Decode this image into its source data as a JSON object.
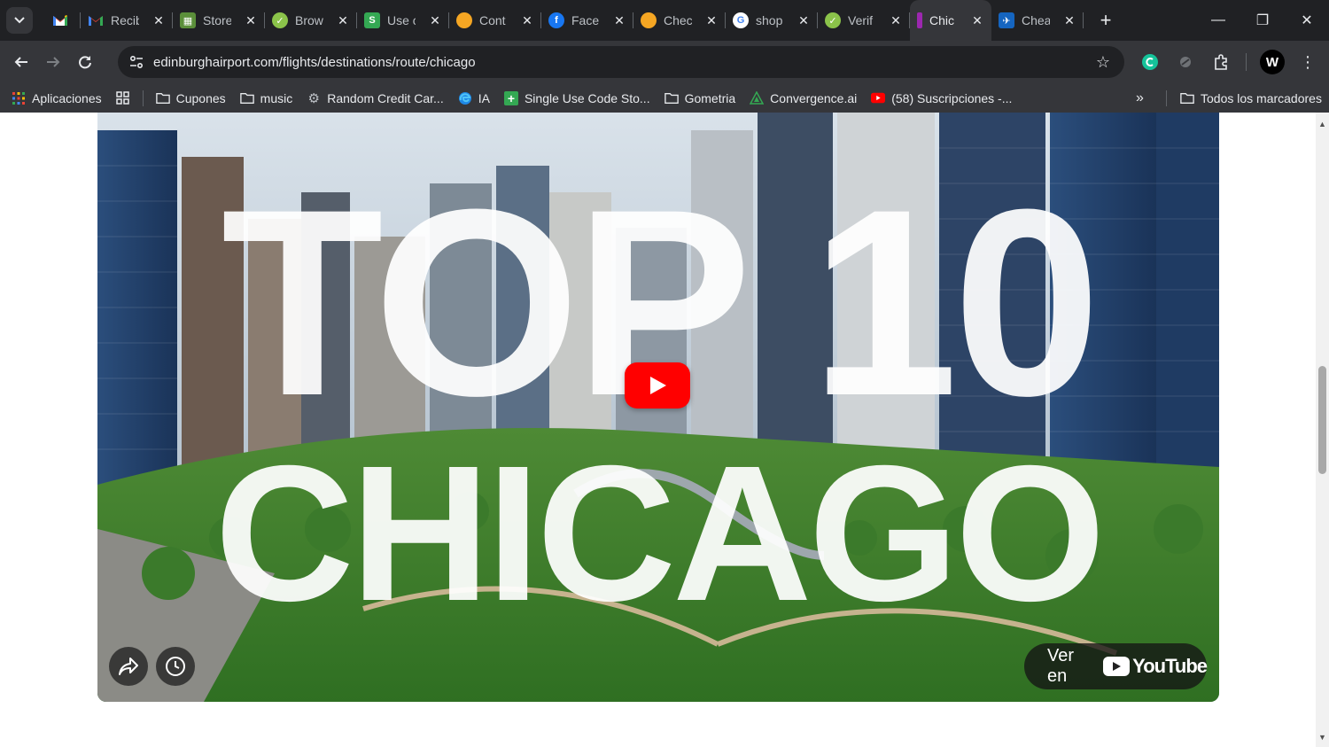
{
  "browser": {
    "tabs": [
      {
        "title": "",
        "icon": "gmail-icon",
        "color": "#ea4335"
      },
      {
        "title": "Recib",
        "icon": "gmail-icon",
        "color": "#ea4335"
      },
      {
        "title": "Store",
        "icon": "store-icon",
        "color": "#4caf50"
      },
      {
        "title": "Brow",
        "icon": "check-circle-icon",
        "color": "#7cb342"
      },
      {
        "title": "Use c",
        "icon": "s-icon",
        "color": "#34a853"
      },
      {
        "title": "Cont",
        "icon": "honey-icon",
        "color": "#f5a623"
      },
      {
        "title": "Facel",
        "icon": "facebook-icon",
        "color": "#1877f2"
      },
      {
        "title": "Chec",
        "icon": "honey-icon",
        "color": "#f5a623"
      },
      {
        "title": "shop",
        "icon": "google-icon",
        "color": "#4285f4"
      },
      {
        "title": "Verif",
        "icon": "check-circle-icon",
        "color": "#7cb342"
      },
      {
        "title": "Chic",
        "icon": "airport-icon",
        "color": "#9c27b0",
        "active": true
      },
      {
        "title": "Chea",
        "icon": "plane-icon",
        "color": "#1565c0"
      }
    ],
    "address_bar": {
      "url": "edinburghairport.com/flights/destinations/route/chicago"
    },
    "bookmarks": [
      {
        "label": "Aplicaciones",
        "icon": "apps-grid-icon"
      },
      {
        "label": "",
        "icon": "grid-icon"
      },
      {
        "label": "Cupones",
        "icon": "folder-icon"
      },
      {
        "label": "music",
        "icon": "folder-icon"
      },
      {
        "label": "Random Credit Car...",
        "icon": "gear-icon"
      },
      {
        "label": "IA",
        "icon": "edge-icon"
      },
      {
        "label": "Single Use Code Sto...",
        "icon": "plus-icon"
      },
      {
        "label": "Gometria",
        "icon": "folder-icon"
      },
      {
        "label": "Convergence.ai",
        "icon": "convergence-icon"
      },
      {
        "label": "(58) Suscripciones -...",
        "icon": "youtube-icon"
      }
    ],
    "all_bookmarks_label": "Todos los marcadores"
  },
  "video": {
    "thumbnail_line1": "TOP 10",
    "thumbnail_line2": "CHICAGO",
    "watch_on_label": "Ver en",
    "youtube_word": "YouTube"
  },
  "colors": {
    "chrome_dark": "#202124",
    "chrome_toolbar": "#35363a",
    "youtube_red": "#ff0000"
  }
}
